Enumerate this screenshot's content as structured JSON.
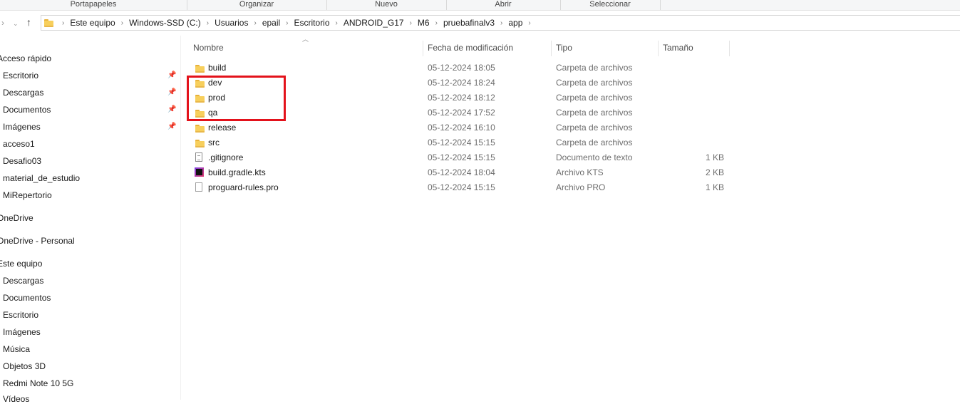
{
  "ribbon": {
    "groups": [
      "Portapapeles",
      "Organizar",
      "Nuevo",
      "Abrir",
      "Seleccionar"
    ]
  },
  "nav_buttons": {
    "forward_icon": "chevron-right-icon",
    "up_icon": "up-arrow-icon"
  },
  "breadcrumb": [
    "Este equipo",
    "Windows-SSD (C:)",
    "Usuarios",
    "epail",
    "Escritorio",
    "ANDROID_G17",
    "M6",
    "pruebafinalv3",
    "app"
  ],
  "nav_pane": {
    "quick_access_label": "Acceso rápido",
    "quick_access_items": [
      {
        "label": "Escritorio",
        "pinned": true
      },
      {
        "label": "Descargas",
        "pinned": true
      },
      {
        "label": "Documentos",
        "pinned": true
      },
      {
        "label": "Imágenes",
        "pinned": true
      },
      {
        "label": "acceso1",
        "pinned": false
      },
      {
        "label": "Desafio03",
        "pinned": false
      },
      {
        "label": "material_de_estudio",
        "pinned": false
      },
      {
        "label": "MiRepertorio",
        "pinned": false
      }
    ],
    "onedrive_label": "OneDrive",
    "onedrive_personal_label": "OneDrive - Personal",
    "this_pc_label": "Este equipo",
    "this_pc_items": [
      "Descargas",
      "Documentos",
      "Escritorio",
      "Imágenes",
      "Música",
      "Objetos 3D",
      "Redmi Note 10 5G",
      "Vídeos"
    ]
  },
  "columns": {
    "name": "Nombre",
    "date": "Fecha de modificación",
    "type": "Tipo",
    "size": "Tamaño"
  },
  "files": [
    {
      "name": "build",
      "date": "05-12-2024 18:05",
      "type": "Carpeta de archivos",
      "size": "",
      "icon": "folder-icon"
    },
    {
      "name": "dev",
      "date": "05-12-2024 18:24",
      "type": "Carpeta de archivos",
      "size": "",
      "icon": "folder-icon"
    },
    {
      "name": "prod",
      "date": "05-12-2024 18:12",
      "type": "Carpeta de archivos",
      "size": "",
      "icon": "folder-icon"
    },
    {
      "name": "qa",
      "date": "05-12-2024 17:52",
      "type": "Carpeta de archivos",
      "size": "",
      "icon": "folder-icon"
    },
    {
      "name": "release",
      "date": "05-12-2024 16:10",
      "type": "Carpeta de archivos",
      "size": "",
      "icon": "folder-icon"
    },
    {
      "name": "src",
      "date": "05-12-2024 15:15",
      "type": "Carpeta de archivos",
      "size": "",
      "icon": "folder-icon"
    },
    {
      "name": ".gitignore",
      "date": "05-12-2024 15:15",
      "type": "Documento de texto",
      "size": "1 KB",
      "icon": "text-file-icon"
    },
    {
      "name": "build.gradle.kts",
      "date": "05-12-2024 18:04",
      "type": "Archivo KTS",
      "size": "2 KB",
      "icon": "kts-file-icon"
    },
    {
      "name": "proguard-rules.pro",
      "date": "05-12-2024 15:15",
      "type": "Archivo PRO",
      "size": "1 KB",
      "icon": "file-icon"
    }
  ],
  "highlight_color": "#e3121b",
  "folder_color": "#f7cf5c"
}
